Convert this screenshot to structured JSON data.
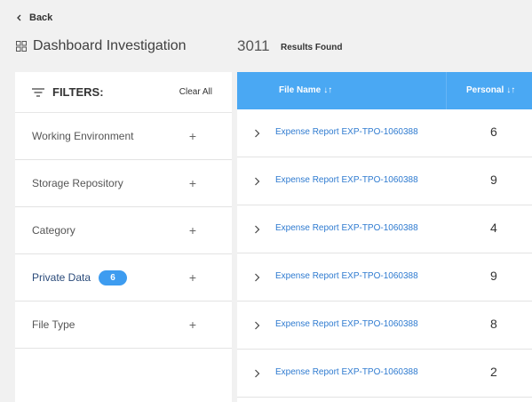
{
  "back": {
    "label": "Back"
  },
  "page": {
    "title": "Dashboard Investigation",
    "results_count": "3011",
    "results_label": "Results Found"
  },
  "filters": {
    "title": "FILTERS:",
    "clear_all": "Clear All",
    "items": [
      {
        "label": "Working Environment",
        "badge": null
      },
      {
        "label": "Storage Repository",
        "badge": null
      },
      {
        "label": "Category",
        "badge": null
      },
      {
        "label": "Private Data",
        "badge": "6"
      },
      {
        "label": "File Type",
        "badge": null
      }
    ],
    "expand_glyph": "+"
  },
  "table": {
    "columns": [
      {
        "label": "File Name",
        "sort_glyph": "↓↑"
      },
      {
        "label": "Personal",
        "sort_glyph": "↓↑"
      }
    ],
    "rows": [
      {
        "file_name": "Expense Report EXP-TPO-1060388",
        "personal": "6"
      },
      {
        "file_name": "Expense Report EXP-TPO-1060388",
        "personal": "9"
      },
      {
        "file_name": "Expense Report EXP-TPO-1060388",
        "personal": "4"
      },
      {
        "file_name": "Expense Report EXP-TPO-1060388",
        "personal": "9"
      },
      {
        "file_name": "Expense Report EXP-TPO-1060388",
        "personal": "8"
      },
      {
        "file_name": "Expense Report EXP-TPO-1060388",
        "personal": "2"
      }
    ]
  },
  "colors": {
    "accent": "#4aa8f3",
    "badge": "#3d9cf0",
    "link": "#2f7bd0",
    "background": "#f1f1f1"
  }
}
